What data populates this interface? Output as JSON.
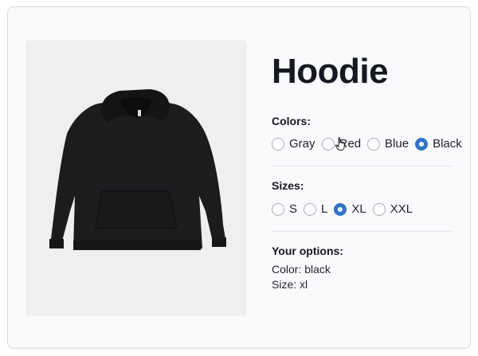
{
  "product": {
    "title": "Hoodie",
    "image_alt": "Black hoodie product photo"
  },
  "colors": {
    "label": "Colors:",
    "options": [
      {
        "label": "Gray",
        "selected": false
      },
      {
        "label": "Red",
        "selected": false
      },
      {
        "label": "Blue",
        "selected": false
      },
      {
        "label": "Black",
        "selected": true
      }
    ]
  },
  "sizes": {
    "label": "Sizes:",
    "options": [
      {
        "label": "S",
        "selected": false
      },
      {
        "label": "L",
        "selected": false
      },
      {
        "label": "XL",
        "selected": true
      },
      {
        "label": "XXL",
        "selected": false
      }
    ]
  },
  "summary": {
    "label": "Your options:",
    "color_line": "Color: black",
    "size_line": "Size: xl"
  },
  "theme": {
    "accent": "#2f74c9",
    "card_background": "#fafafc",
    "image_background": "#efeff1"
  }
}
